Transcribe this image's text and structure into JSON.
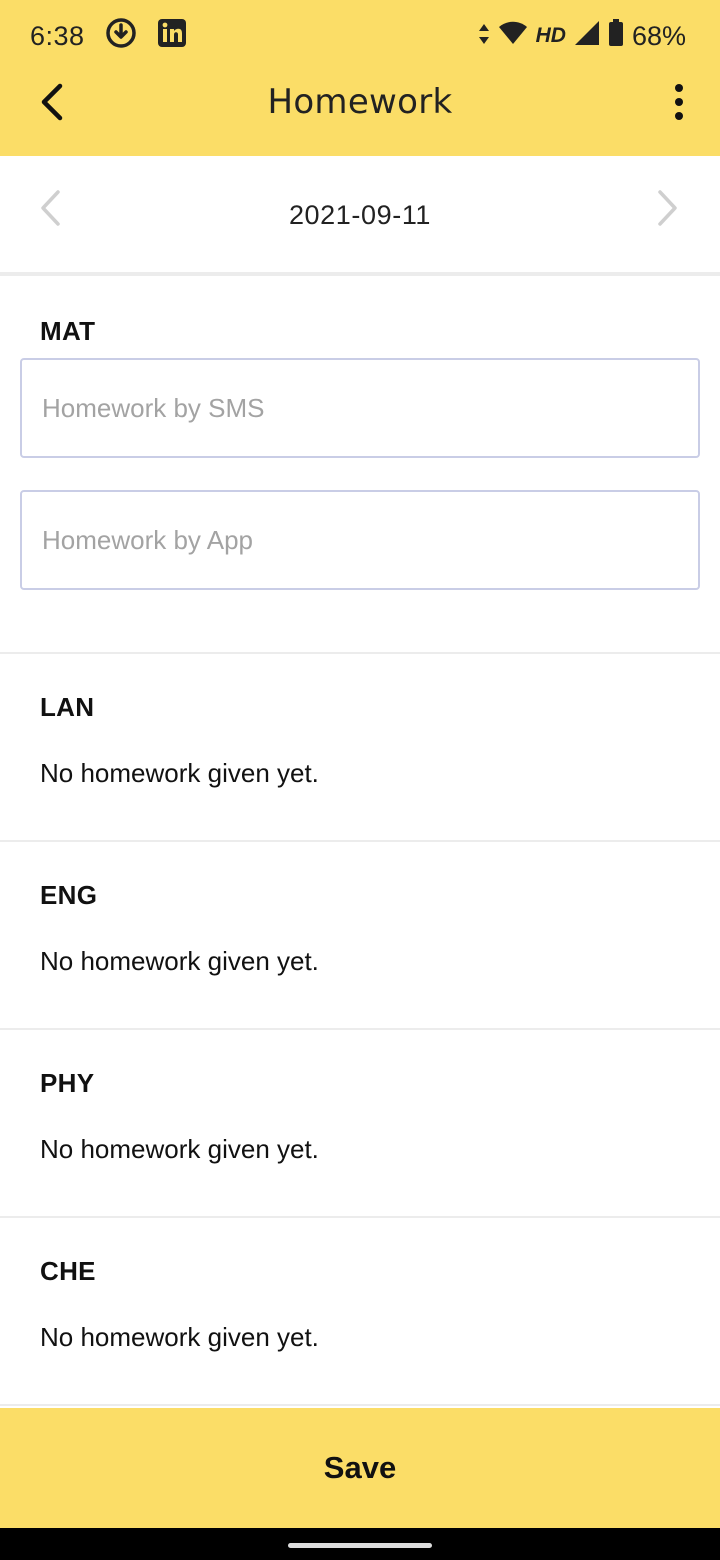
{
  "status_bar": {
    "time": "6:38",
    "network_label": "HD",
    "battery": "68%",
    "icons": [
      "download-icon",
      "linkedin-icon",
      "data-arrows-icon",
      "wifi-icon",
      "signal-icon",
      "battery-icon"
    ]
  },
  "app_bar": {
    "title": "Homework",
    "back_icon": "arrow-back-icon",
    "menu_icon": "more-vert-icon"
  },
  "date_nav": {
    "date": "2021-09-11",
    "prev_icon": "chevron-left-icon",
    "next_icon": "chevron-right-icon"
  },
  "subjects": [
    {
      "code": "MAT",
      "sms_placeholder": "Homework by SMS",
      "sms_value": "",
      "app_placeholder": "Homework by App",
      "app_value": ""
    },
    {
      "code": "LAN",
      "status": "No homework given yet."
    },
    {
      "code": "ENG",
      "status": "No homework given yet."
    },
    {
      "code": "PHY",
      "status": "No homework given yet."
    },
    {
      "code": "CHE",
      "status": "No homework given yet."
    }
  ],
  "save_label": "Save",
  "colors": {
    "accent": "#fbdd67",
    "divider": "#ececec",
    "input_border": "#c9cde6"
  }
}
